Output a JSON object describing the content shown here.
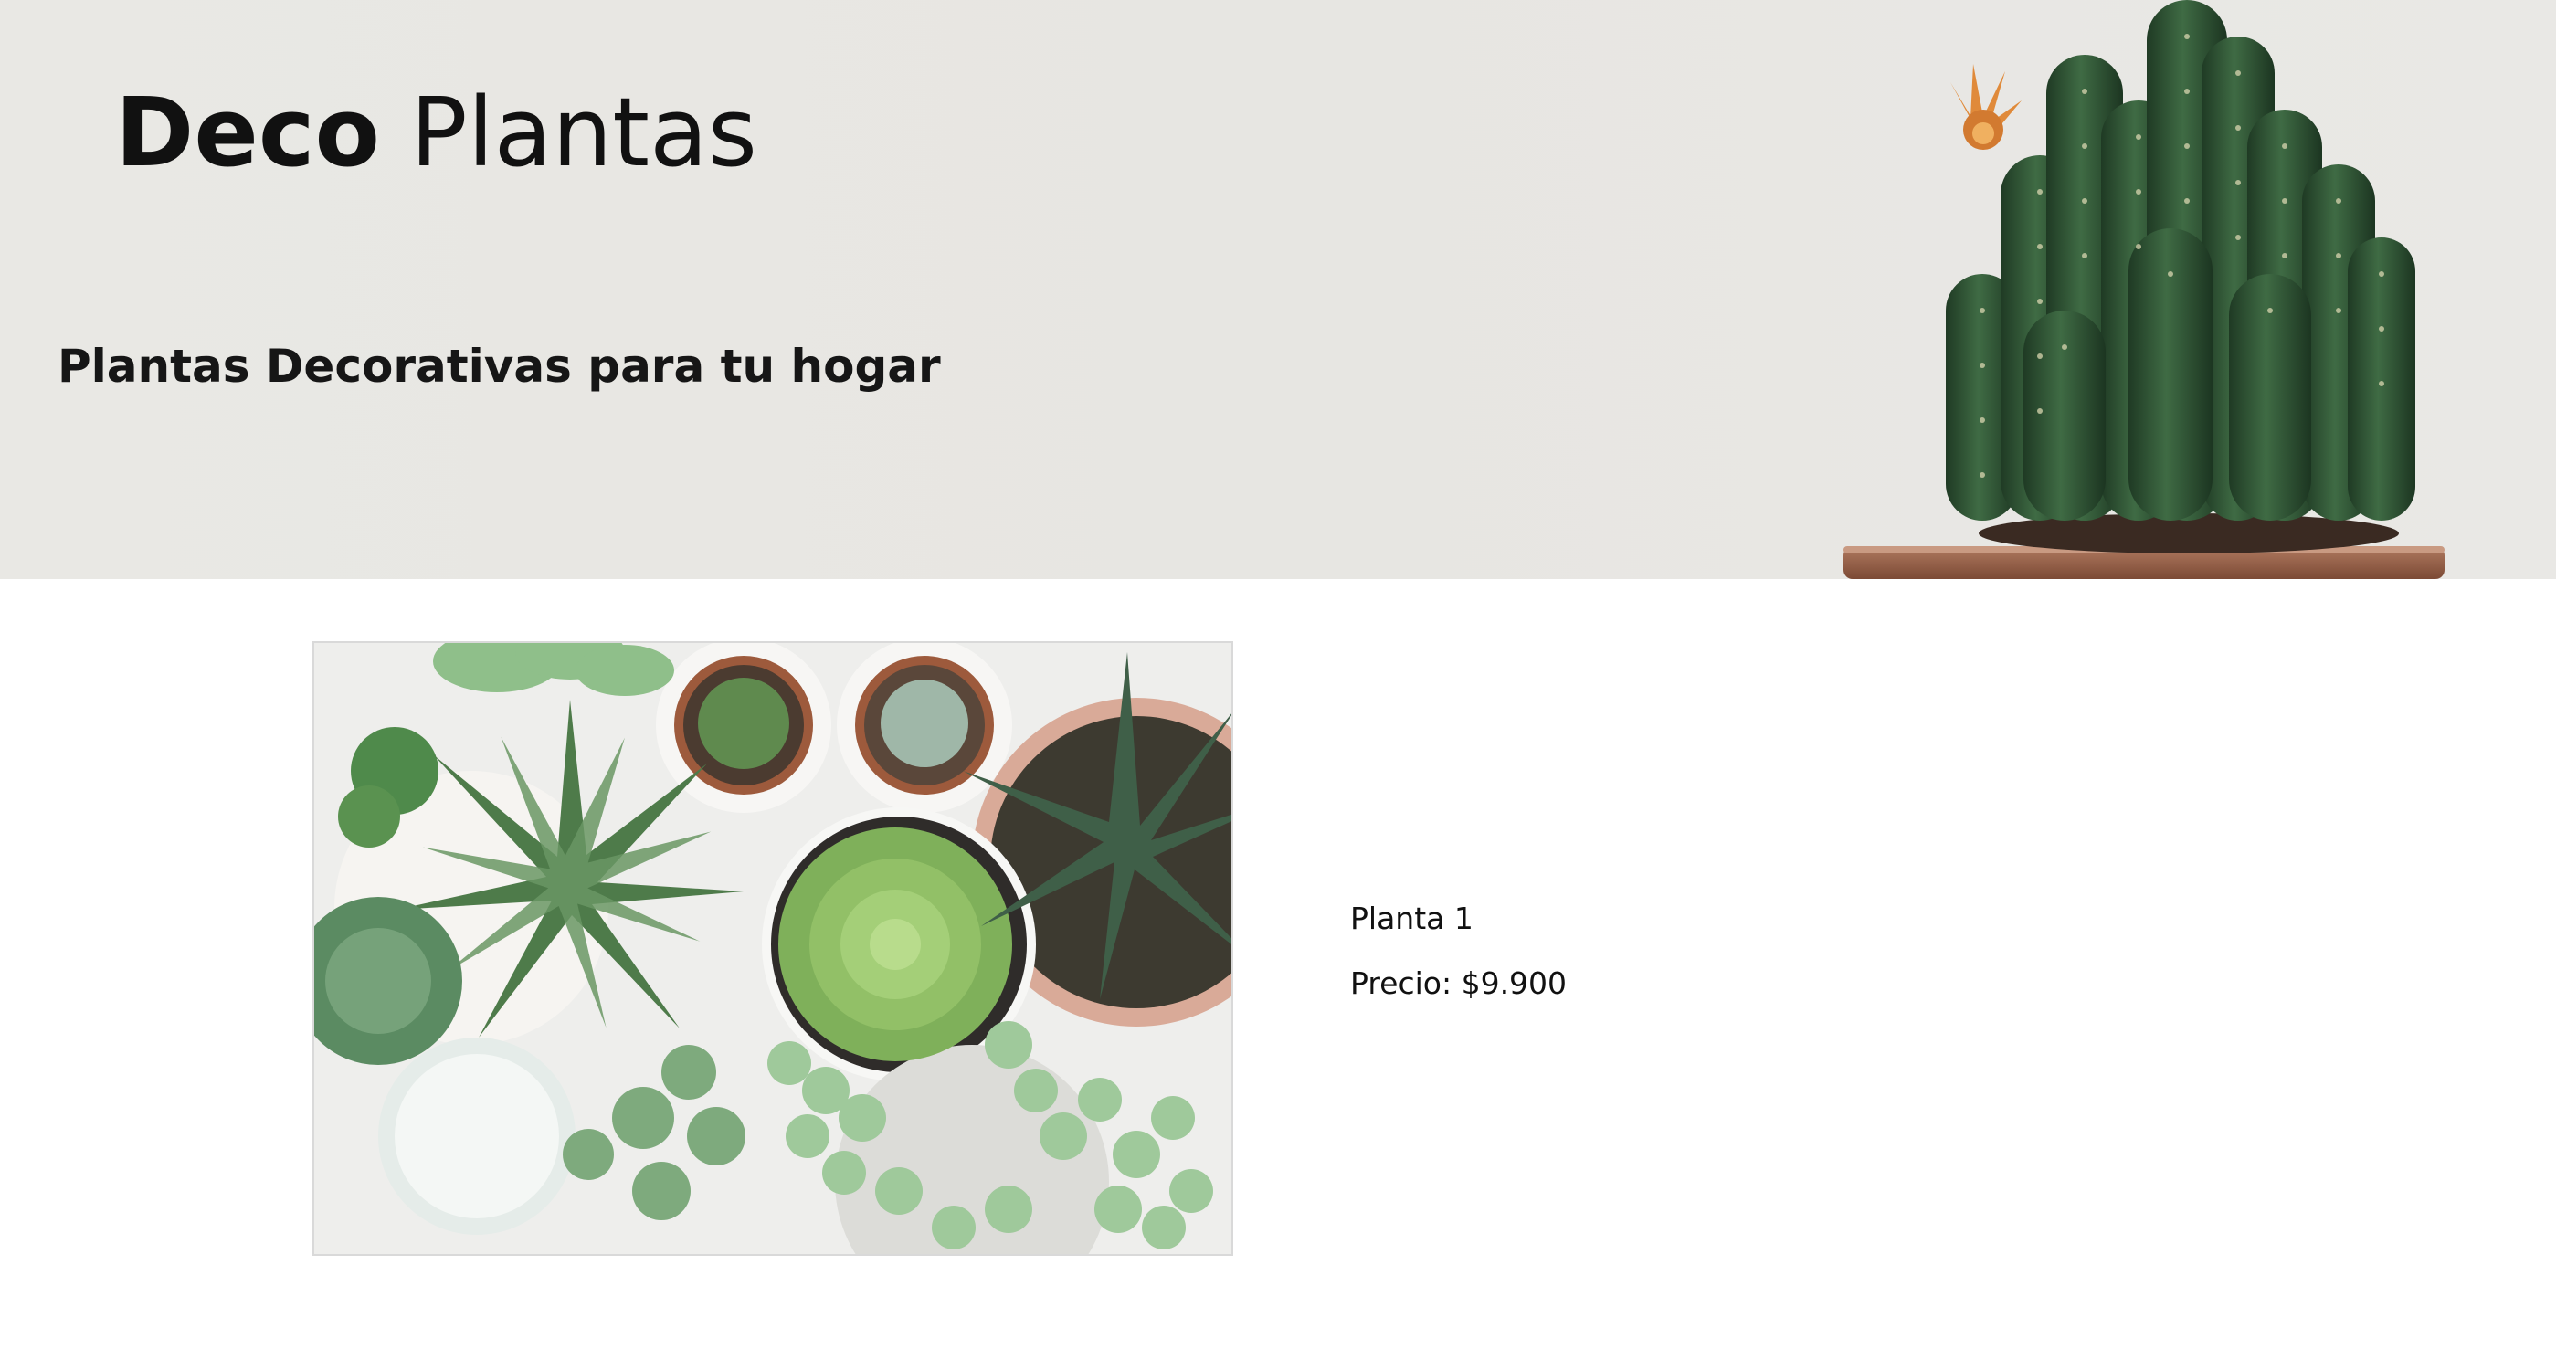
{
  "header": {
    "brand_strong": "Deco",
    "brand_rest": "Plantas",
    "tagline": "Plantas Decorativas para tu hogar",
    "hero_icon": "cactus-photo"
  },
  "products": [
    {
      "name": "Planta 1",
      "price": "Precio: $9.900",
      "image_icon": "succulents-photo"
    }
  ],
  "colors": {
    "hero_background": "#e8e7e3",
    "page_background": "#ffffff",
    "text": "#111111"
  }
}
